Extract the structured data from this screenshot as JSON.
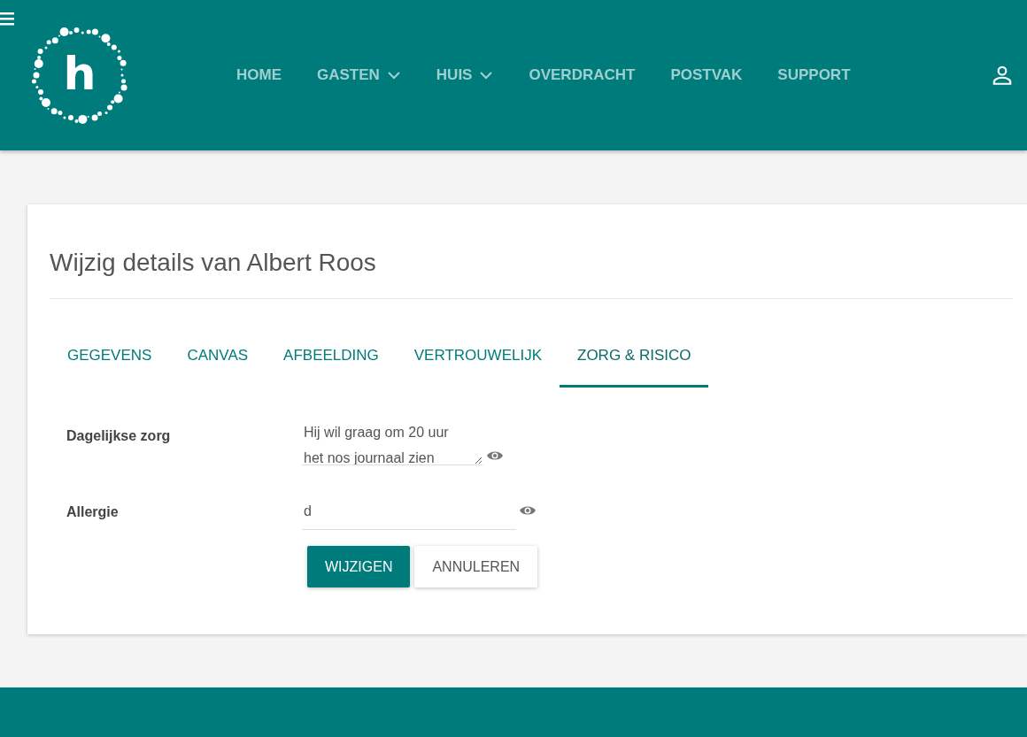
{
  "logo": {
    "letter": "h"
  },
  "nav": [
    {
      "label": "HOME",
      "dropdown": false
    },
    {
      "label": "GASTEN",
      "dropdown": true
    },
    {
      "label": "HUIS",
      "dropdown": true
    },
    {
      "label": "OVERDRACHT",
      "dropdown": false
    },
    {
      "label": "POSTVAK",
      "dropdown": false
    },
    {
      "label": "SUPPORT",
      "dropdown": false
    }
  ],
  "card": {
    "title": "Wijzig details van Albert Roos",
    "tabs": [
      {
        "label": "GEGEVENS",
        "selected": false
      },
      {
        "label": "CANVAS",
        "selected": false
      },
      {
        "label": "AFBEELDING",
        "selected": false
      },
      {
        "label": "VERTROUWELIJK",
        "selected": false
      },
      {
        "label": "ZORG & RISICO",
        "selected": true
      }
    ],
    "fields": [
      {
        "label": "Dagelijkse zorg",
        "kind": "textarea",
        "value": "Hij wil graag om 20 uur het nos journaal zien"
      },
      {
        "label": "Allergie",
        "kind": "input",
        "value": "d"
      }
    ],
    "buttons": [
      {
        "label": "WIJZIGEN",
        "kind": "primary"
      },
      {
        "label": "ANNULEREN",
        "kind": "secondary"
      }
    ]
  }
}
